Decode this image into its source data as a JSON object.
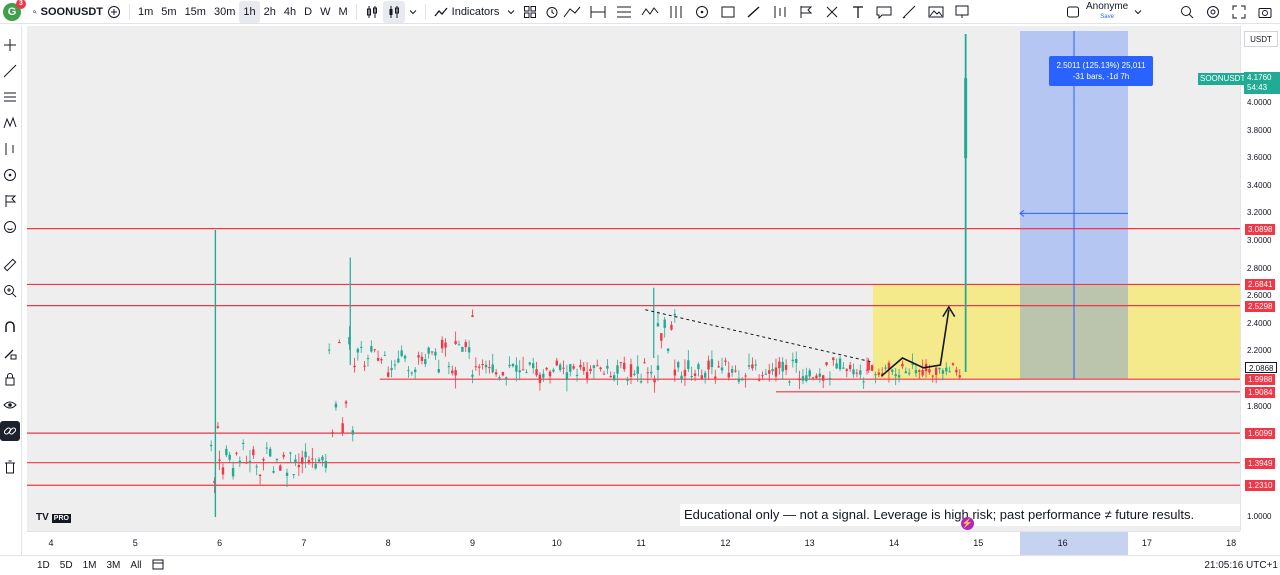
{
  "header": {
    "symbol": "SOONUSDT",
    "notification_count": "3",
    "intervals": [
      "1m",
      "5m",
      "15m",
      "30m",
      "1h",
      "2h",
      "4h",
      "D",
      "W",
      "M"
    ],
    "active_interval": "1h",
    "indicators_label": "Indicators",
    "account_name": "Anonyme",
    "account_save": "Save"
  },
  "price_scale": {
    "currency": "USDT",
    "labels": [
      "4.0000",
      "3.8000",
      "3.6000",
      "3.4000",
      "3.2000",
      "3.0000",
      "2.8000",
      "2.6000",
      "2.4000",
      "2.2000",
      "1.8000",
      "1.0000"
    ],
    "level_badges": [
      "3.0898",
      "2.6841",
      "2.5298",
      "1.9988",
      "1.9084",
      "1.6099",
      "1.3949",
      "1.2310"
    ],
    "current_price_badge": "2.0868",
    "symbol_tag": "SOONUSDT",
    "last_price": "4.1760",
    "countdown": "54:43"
  },
  "time_scale": {
    "labels": [
      "4",
      "5",
      "6",
      "7",
      "8",
      "9",
      "10",
      "11",
      "12",
      "13",
      "14",
      "15",
      "16",
      "17",
      "18"
    ],
    "highlighted": "16"
  },
  "measure": {
    "line1": "2.5011 (125.13%) 25,011",
    "line2": "-31 bars, -1d 7h"
  },
  "disclaimer": "Educational only — not a signal. Leverage is high risk; past performance ≠ future results.",
  "branding": {
    "logo_pro": "PRO"
  },
  "bottom": {
    "ranges": [
      "1D",
      "5D",
      "1M",
      "3M",
      "All"
    ],
    "clock": "21:05:16 UTC+1"
  },
  "colors": {
    "level_line": "#f23645",
    "up": "#22ab94",
    "down": "#f23645",
    "zone": "#f5e97a",
    "measure": "#2962ff"
  },
  "chart_data": {
    "type": "candlestick",
    "horizontal_levels": [
      3.0898,
      2.6841,
      2.5298,
      1.9988,
      1.9084,
      1.6099,
      1.3949,
      1.231
    ],
    "yaxis_ticks": [
      1.0,
      1.8,
      2.2,
      2.4,
      2.6,
      2.8,
      3.0,
      3.2,
      3.4,
      3.6,
      3.8,
      4.0
    ],
    "xaxis_ticks": [
      "4",
      "5",
      "6",
      "7",
      "8",
      "9",
      "10",
      "11",
      "12",
      "13",
      "14",
      "15",
      "16",
      "17",
      "18"
    ],
    "last_price": 4.176
  }
}
